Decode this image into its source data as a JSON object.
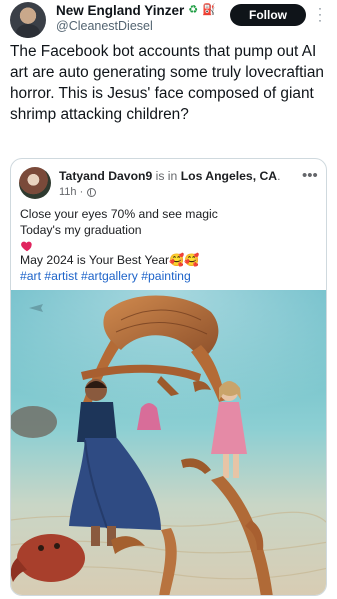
{
  "post": {
    "display_name": "New England Yinzer",
    "badges": [
      "recycle-badge-icon",
      "fuel-pump-badge-icon"
    ],
    "handle": "@CleanestDiesel",
    "follow_label": "Follow",
    "text": "The Facebook bot accounts that pump out AI art are auto generating some truly lovecraftian horror. This is Jesus' face composed of giant shrimp attacking children?"
  },
  "quoted": {
    "author": "Tatyand Davon9",
    "connector": " is in ",
    "location": "Los Angeles, CA",
    "location_suffix": ".",
    "time": "11h ·",
    "lines": {
      "l1": "Close your eyes 70% and see magic",
      "l2": "Today's my graduation",
      "l4": "May 2024 is Your Best Year",
      "l4_emoji": "🥰🥰",
      "hashtags": "#art #artist #artgallery #painting"
    },
    "image_description_icons": [
      "heart-emoji-icon",
      "globe-icon",
      "more-icon"
    ]
  },
  "colors": {
    "follow_bg": "#0f1419",
    "link": "#1d63c9",
    "water": "#7ec6cf",
    "sand": "#d9cdb6",
    "shrimp": "#b8733f"
  }
}
